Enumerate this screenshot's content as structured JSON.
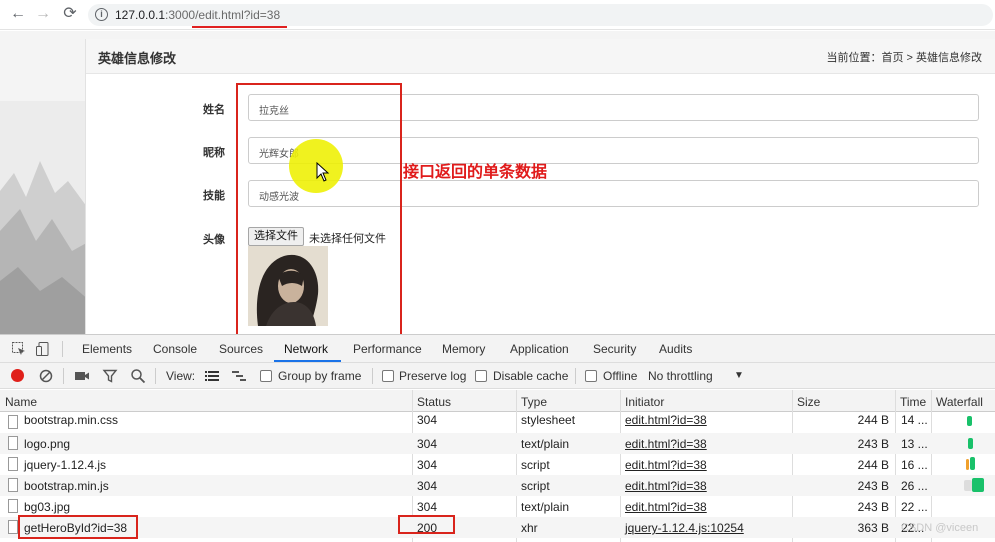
{
  "browser": {
    "back": "←",
    "forward": "→",
    "reload": "⟳",
    "info": "i",
    "url_host": "127.0.0.1",
    "url_rest": ":3000/edit.html?id=38"
  },
  "page": {
    "title": "英雄信息修改",
    "breadcrumb": "当前位置：首页 > 英雄信息修改",
    "fields": [
      {
        "label": "姓名",
        "value": "拉克丝"
      },
      {
        "label": "昵称",
        "value": "光辉女郎"
      },
      {
        "label": "技能",
        "value": "动感光波"
      }
    ],
    "avatar_label": "头像",
    "file_button": "选择文件",
    "file_none": "未选择任何文件"
  },
  "annotation": "接口返回的单条数据",
  "devtools": {
    "tabs": [
      "Elements",
      "Console",
      "Sources",
      "Network",
      "Performance",
      "Memory",
      "Application",
      "Security",
      "Audits"
    ],
    "active_tab": "Network",
    "toolbar": {
      "view": "View:",
      "group_by_frame": "Group by frame",
      "preserve_log": "Preserve log",
      "disable_cache": "Disable cache",
      "offline": "Offline",
      "throttling": "No throttling",
      "dropdown": "▼"
    },
    "columns": [
      "Name",
      "Status",
      "Type",
      "Initiator",
      "Size",
      "Time",
      "Waterfall"
    ],
    "rows": [
      {
        "name": "bootstrap.min.css",
        "status": "304",
        "type": "stylesheet",
        "initiator": "edit.html?id=38",
        "size": "244 B",
        "time": "14 ..."
      },
      {
        "name": "logo.png",
        "status": "304",
        "type": "text/plain",
        "initiator": "edit.html?id=38",
        "size": "243 B",
        "time": "13 ..."
      },
      {
        "name": "jquery-1.12.4.js",
        "status": "304",
        "type": "script",
        "initiator": "edit.html?id=38",
        "size": "244 B",
        "time": "16 ..."
      },
      {
        "name": "bootstrap.min.js",
        "status": "304",
        "type": "script",
        "initiator": "edit.html?id=38",
        "size": "243 B",
        "time": "26 ..."
      },
      {
        "name": "bg03.jpg",
        "status": "304",
        "type": "text/plain",
        "initiator": "edit.html?id=38",
        "size": "243 B",
        "time": "22 ..."
      },
      {
        "name": "getHeroById?id=38",
        "status": "200",
        "type": "xhr",
        "initiator": "jquery-1.12.4.js:10254",
        "size": "363 B",
        "time": "22..."
      }
    ]
  },
  "watermark": "CSDN @viceen",
  "colors": {
    "accent_red": "#d9241c",
    "devtools_blue": "#1a73e8",
    "waterfall_green": "#19c16a"
  }
}
